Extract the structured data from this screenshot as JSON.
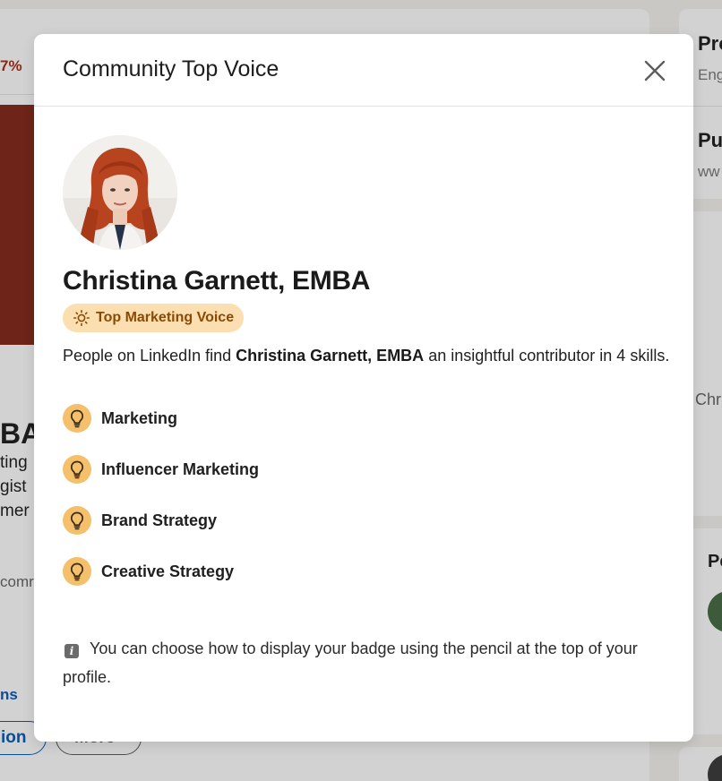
{
  "background": {
    "percent_fragment": "7%",
    "name_fragment": "BA",
    "headline_fragments": [
      "ting",
      "gist",
      "mer"
    ],
    "location_fragment": "comr",
    "link_fragment": "ns",
    "primary_button_fragment": "ion",
    "more_button": "More",
    "side_panel": {
      "heading_1": "Pro",
      "sub_1": "Eng",
      "heading_2": "Pu",
      "sub_2": "ww",
      "text_3": "Chr",
      "heading_4": "Pe"
    },
    "banner_color": "#6e2418"
  },
  "modal": {
    "title": "Community Top Voice",
    "close_label": "Close",
    "profile": {
      "name": "Christina Garnett, EMBA",
      "badge_label": "Top Marketing Voice",
      "intro_prefix": "People on LinkedIn find ",
      "intro_name": "Christina Garnett, EMBA",
      "intro_suffix": " an insightful contributor in 4 skills."
    },
    "skills": [
      {
        "label": "Marketing",
        "icon": "lightbulb-icon"
      },
      {
        "label": "Influencer Marketing",
        "icon": "lightbulb-icon"
      },
      {
        "label": "Brand Strategy",
        "icon": "lightbulb-icon"
      },
      {
        "label": "Creative Strategy",
        "icon": "lightbulb-icon"
      }
    ],
    "info_text": "You can choose how to display your badge using the pencil at the top of your profile."
  },
  "colors": {
    "badge_background": "#fbdfb1",
    "badge_text": "#8a4a06",
    "skill_icon_background": "#f5c06b"
  }
}
